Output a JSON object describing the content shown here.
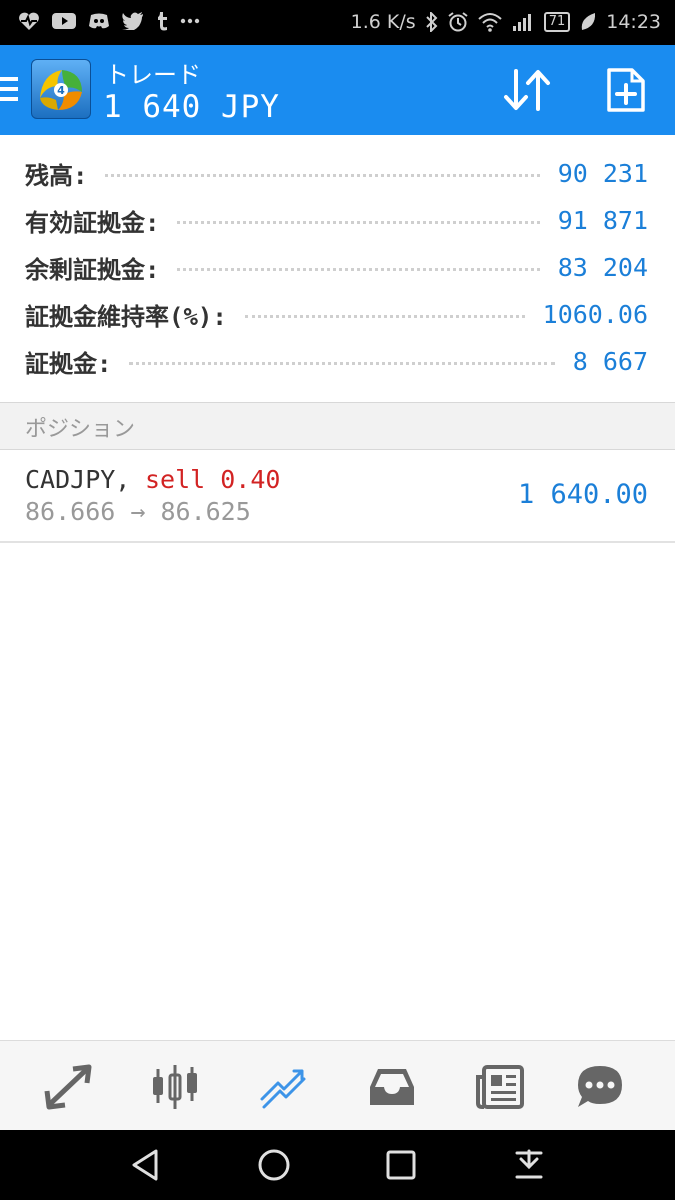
{
  "status_bar": {
    "network_speed": "1.6 K/s",
    "battery": "71",
    "time": "14:23",
    "left_icons": [
      "heart-rate-icon",
      "youtube-icon",
      "discord-icon",
      "twitter-icon",
      "tumblr-icon",
      "more-icon"
    ],
    "right_icons": [
      "bluetooth-icon",
      "alarm-icon",
      "wifi-icon",
      "signal-icon",
      "battery-icon",
      "leaf-icon"
    ]
  },
  "app_bar": {
    "title": "トレード",
    "subtitle": "1 640 JPY"
  },
  "summary": [
    {
      "label": "残高:",
      "value": "90 231"
    },
    {
      "label": "有効証拠金:",
      "value": "91 871"
    },
    {
      "label": "余剰証拠金:",
      "value": "83 204"
    },
    {
      "label": "証拠金維持率(%):",
      "value": "1060.06"
    },
    {
      "label": "証拠金:",
      "value": "8 667"
    }
  ],
  "section": {
    "title": "ポジション"
  },
  "position": {
    "symbol": "CADJPY,",
    "side": "sell 0.40",
    "prices": "86.666 → 86.625",
    "profit": "1 640.00"
  },
  "colors": {
    "app_bar": "#1a8cf0",
    "value_blue": "#1b7fd8",
    "sell_red": "#d22323",
    "muted_gray": "#999999"
  },
  "tabs": [
    "quotes-icon",
    "chart-icon",
    "trade-icon",
    "history-icon",
    "news-icon",
    "chat-icon"
  ],
  "nav": [
    "back-icon",
    "home-icon",
    "recents-icon",
    "notification-shade-icon"
  ]
}
